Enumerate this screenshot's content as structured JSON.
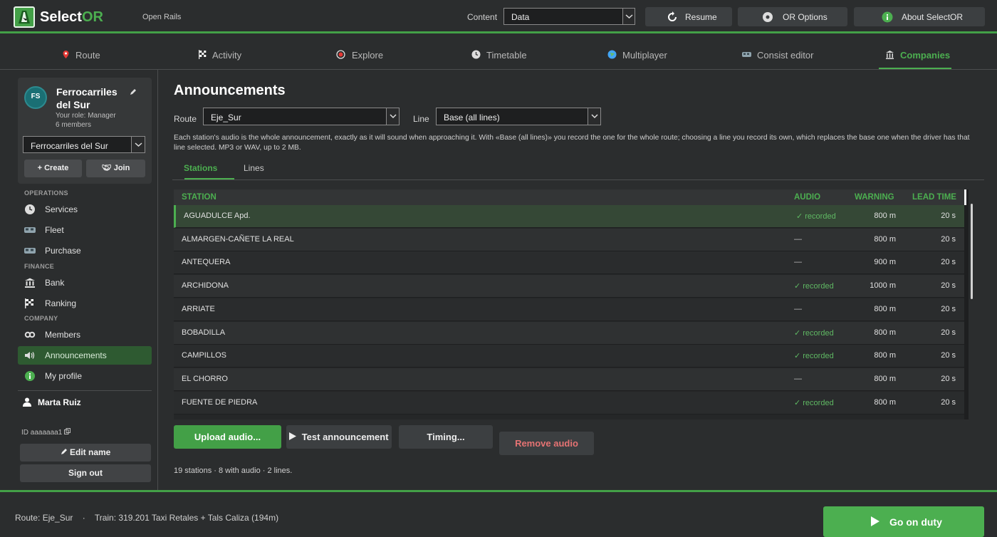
{
  "app": {
    "title_main": "Select",
    "title_accent": "OR",
    "subtitle": "Open Rails",
    "content_label": "Content",
    "content_value": "Data",
    "buttons": {
      "resume": "Resume",
      "options": "OR Options",
      "about": "About SelectOR"
    }
  },
  "nav": {
    "tabs": [
      {
        "label": "Route"
      },
      {
        "label": "Activity"
      },
      {
        "label": "Explore"
      },
      {
        "label": "Timetable"
      },
      {
        "label": "Multiplayer"
      },
      {
        "label": "Consist editor"
      },
      {
        "label": "Companies"
      }
    ],
    "active": "Companies"
  },
  "sidebar": {
    "company": {
      "initials": "FS",
      "name": "Ferrocarriles del Sur",
      "role": "Your role: Manager",
      "members": "6 members",
      "select_value": "Ferrocarriles del Sur",
      "create": "+ Create",
      "join": "Join"
    },
    "sections": {
      "operations": "OPERATIONS",
      "finance": "FINANCE",
      "company": "COMPANY"
    },
    "items": {
      "services": "Services",
      "fleet": "Fleet",
      "purchase": "Purchase",
      "bank": "Bank",
      "ranking": "Ranking",
      "members": "Members",
      "announcements": "Announcements",
      "my_profile": "My profile"
    },
    "user": {
      "name": "Marta Ruiz",
      "id": "ID aaaaaaa1",
      "edit_name": "Edit name",
      "sign_out": "Sign out"
    }
  },
  "main": {
    "title": "Announcements",
    "route_label": "Route",
    "route_value": "Eje_Sur",
    "line_label": "Line",
    "line_value": "Base (all lines)",
    "help": "Each station's audio is the whole announcement, exactly as it will sound when approaching it. With «Base (all lines)» you record the one for the whole route; choosing a line you record its own, which replaces the base one when the driver has that line selected. MP3 or WAV, up to 2 MB.",
    "subtabs": {
      "stations": "Stations",
      "lines": "Lines"
    },
    "table": {
      "headers": {
        "station": "STATION",
        "audio": "AUDIO",
        "warning": "WARNING",
        "lead": "LEAD TIME"
      },
      "rows": [
        {
          "station": "AGUADULCE Apd.",
          "audio": "✓ recorded",
          "warning": "800 m",
          "lead": "20 s"
        },
        {
          "station": "ALMARGEN-CAÑETE LA REAL",
          "audio": "—",
          "warning": "800 m",
          "lead": "20 s"
        },
        {
          "station": "ANTEQUERA",
          "audio": "—",
          "warning": "900 m",
          "lead": "20 s"
        },
        {
          "station": "ARCHIDONA",
          "audio": "✓ recorded",
          "warning": "1000 m",
          "lead": "20 s"
        },
        {
          "station": "ARRIATE",
          "audio": "—",
          "warning": "800 m",
          "lead": "20 s"
        },
        {
          "station": "BOBADILLA",
          "audio": "✓ recorded",
          "warning": "800 m",
          "lead": "20 s"
        },
        {
          "station": "CAMPILLOS",
          "audio": "✓ recorded",
          "warning": "800 m",
          "lead": "20 s"
        },
        {
          "station": "EL CHORRO",
          "audio": "—",
          "warning": "800 m",
          "lead": "20 s"
        },
        {
          "station": "FUENTE DE PIEDRA",
          "audio": "✓ recorded",
          "warning": "800 m",
          "lead": "20 s"
        }
      ]
    },
    "actions": {
      "upload": "Upload audio...",
      "test": "Test announcement",
      "timing": "Timing...",
      "remove": "Remove audio"
    },
    "summary": "19 stations · 8 with audio · 2 lines."
  },
  "footer": {
    "status": "Route: Eje_Sur    ·    Train: 319.201 Taxi Retales + Tals Caliza (194m)",
    "go_on_duty": "Go on duty"
  },
  "colors": {
    "accent": "#43a047",
    "accent_text": "#4caf50",
    "danger": "#e57373",
    "background": "#2b2d2e"
  }
}
